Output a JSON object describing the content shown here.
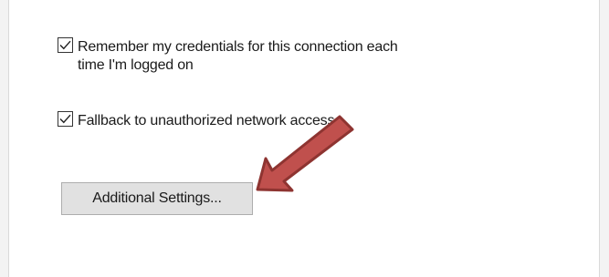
{
  "options": {
    "remember_credentials": {
      "label_line1": "Remember my credentials for this connection each",
      "label_line2": "time I'm logged on",
      "checked": true
    },
    "fallback_access": {
      "label": "Fallback to unauthorized network access",
      "checked": true
    }
  },
  "buttons": {
    "additional_settings_label": "Additional Settings..."
  },
  "annotation": {
    "arrow_color": "#c0504d",
    "arrow_stroke_color": "#8e3431",
    "points_to": "additional-settings-button"
  },
  "icons": {
    "checkbox_check": "check-icon",
    "pointer": "red-arrow-icon"
  }
}
